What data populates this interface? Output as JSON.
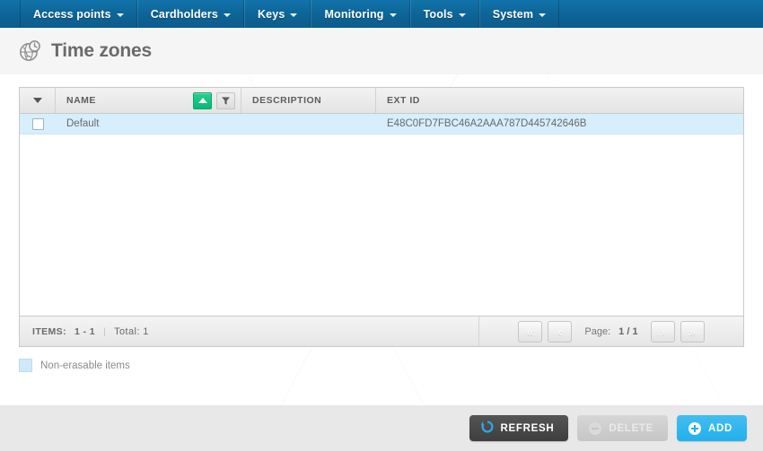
{
  "navbar": {
    "items": [
      {
        "label": "Access points",
        "icon": "chevron-down-icon"
      },
      {
        "label": "Cardholders",
        "icon": "chevron-down-icon"
      },
      {
        "label": "Keys",
        "icon": "chevron-down-icon"
      },
      {
        "label": "Monitoring",
        "icon": "chevron-down-icon"
      },
      {
        "label": "Tools",
        "icon": "chevron-down-icon"
      },
      {
        "label": "System",
        "icon": "chevron-down-icon"
      }
    ]
  },
  "page": {
    "title": "Time zones",
    "icon": "globe-clock-icon"
  },
  "table": {
    "columns": [
      {
        "key": "check",
        "label": "",
        "icon": "chevron-down-icon"
      },
      {
        "key": "name",
        "label": "NAME"
      },
      {
        "key": "description",
        "label": "DESCRIPTION"
      },
      {
        "key": "ext_id",
        "label": "EXT ID"
      }
    ],
    "header_tools": {
      "sort_icon": "sort-ascending-icon",
      "sort_active": true,
      "filter_icon": "filter-funnel-icon"
    },
    "rows": [
      {
        "selected": false,
        "name": "Default",
        "description": "",
        "ext_id": "E48C0FD7FBC46A2AAA787D445742646B"
      }
    ]
  },
  "footer": {
    "items_label": "ITEMS:",
    "items_range": "1 - 1",
    "separator": "|",
    "total_label": "Total: 1",
    "pager": {
      "first_icon": "«",
      "prev_icon": "‹",
      "page_label": "Page:",
      "page_value": "1 / 1",
      "next_icon": "›",
      "last_icon": "»"
    }
  },
  "legend": {
    "swatch_color": "#cde9fa",
    "text": "Non-erasable items"
  },
  "actions": {
    "refresh": {
      "label": "REFRESH",
      "icon": "refresh-icon"
    },
    "delete": {
      "label": "DELETE",
      "icon": "minus-circle-icon",
      "disabled": true
    },
    "add": {
      "label": "ADD",
      "icon": "plus-circle-icon"
    }
  },
  "colors": {
    "nav_blue": "#0e6699",
    "accent_blue": "#23b0ec",
    "sort_green": "#09b877",
    "row_highlight": "#d7eefc"
  }
}
